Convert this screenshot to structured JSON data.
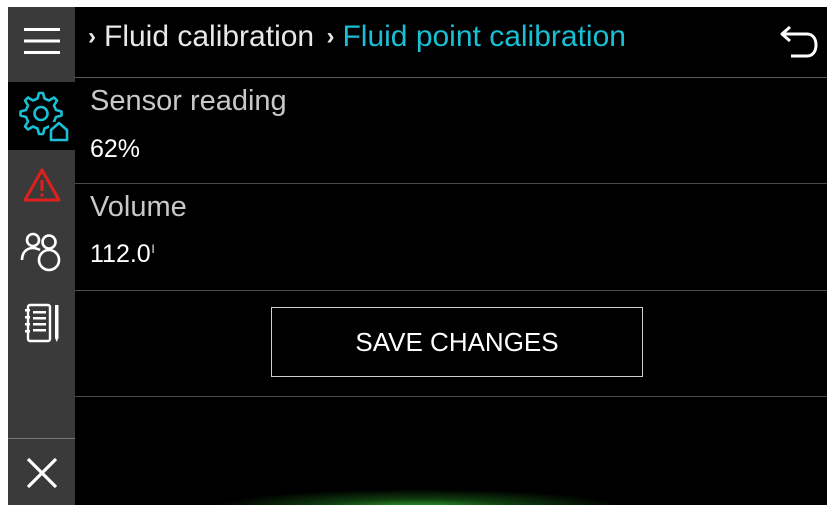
{
  "breadcrumb": {
    "parent": "Fluid calibration",
    "current": "Fluid point calibration",
    "separator": "›"
  },
  "fields": {
    "sensor_reading": {
      "label": "Sensor reading",
      "value": "62%"
    },
    "volume": {
      "label": "Volume",
      "value": "112.0",
      "unit": "l"
    }
  },
  "actions": {
    "save_label": "SAVE CHANGES"
  },
  "sidebar": {
    "items": [
      {
        "icon": "menu-icon"
      },
      {
        "icon": "settings-home-icon",
        "active": true
      },
      {
        "icon": "warning-icon",
        "color": "#e0201c"
      },
      {
        "icon": "users-icon"
      },
      {
        "icon": "log-book-icon"
      },
      {
        "icon": "close-icon"
      }
    ]
  },
  "header": {
    "back_icon": "back-arrow-icon"
  },
  "colors": {
    "accent": "#19bfd4",
    "sidebar_bg": "#3a3a3a",
    "background": "#000000",
    "warning": "#e0201c"
  }
}
